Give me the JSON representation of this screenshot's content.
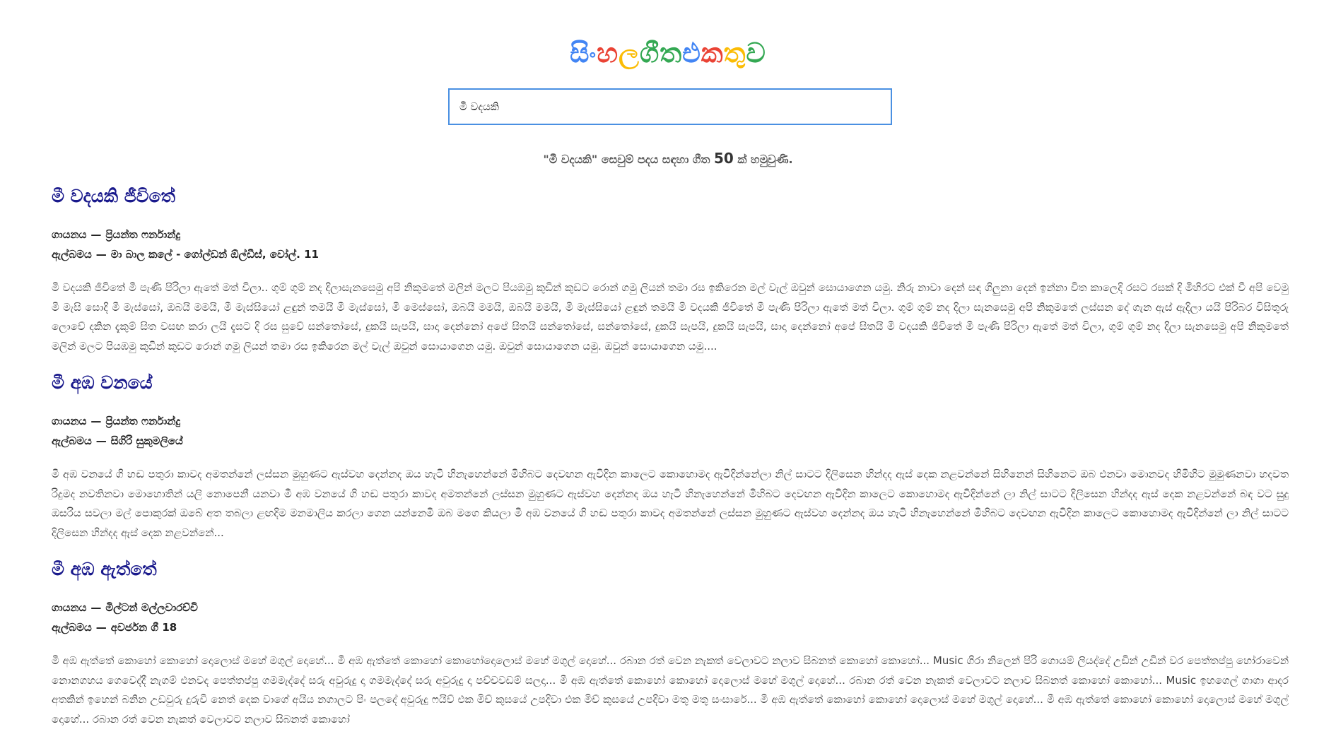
{
  "logo": {
    "letters": [
      {
        "text": "සිං",
        "color": "#4285f4"
      },
      {
        "text": "හ",
        "color": "#ea4335"
      },
      {
        "text": "ල ",
        "color": "#fbbc05"
      },
      {
        "text": "ගී",
        "color": "#34a853"
      },
      {
        "text": "ත ",
        "color": "#34a853"
      },
      {
        "text": "එ",
        "color": "#4285f4"
      },
      {
        "text": "ක",
        "color": "#ea4335"
      },
      {
        "text": "තු",
        "color": "#fbbc05"
      },
      {
        "text": "ව",
        "color": "#34a853"
      }
    ]
  },
  "search": {
    "value": "මී වදයකි"
  },
  "result_summary": {
    "prefix": "\"මී වදයකි\" සෙවුම් පදය සඳහා ගීත",
    "count": "50",
    "suffix": "ක් හමුවුණි."
  },
  "songs": [
    {
      "title": "මී වදයකි ජීවිතේ",
      "singer_label": "ගායනය",
      "singer": "ප්‍රියන්ත ෆර්නාන්දු",
      "album_label": "ඇල්බමය",
      "album": "මා බාල කලේ - ගෝල්ඩන් ඕල්ඩීස්, වෝල්. 11",
      "lyrics": "මී වදයකි ජීවිතේ මී පැණි පිරිලා ඇතේ මත් විලා.. ගුම් ගුම් නද දිලාසැනසෙමු අපි නිකුමතේ මලින් මලට පියඹමු කුඩින් කුඩට රොන් ගමු ලියන් තමා රස ඉකිරෙන මල් වැල් ඔවුන් සොයාගෙන යමු. නිරු නාවා දෙන් සඳ ගිලුනා දෙන් ඉන්නා විත කාලෙදි රසට රසක් දි මිහිරට එක් වී අපි වෙමු මී මැසි සොදි මී මැස්සෝ, ඔබයි මමයි, මී මැස්සියෝ ළඳුන් තමයි මී මැස්සෝ, මී මෙස්සෝ, ඔබයි මමයි, ඔබයි මමයි, මී මැස්සියෝ ළඳුන් තමයි මී වදයකි ජීවිතේ මී පැණි පිරිලා ඇතේ මත් විලා. ගුම් ගුම් නද දිලා සැනසෙමු අපි නිකුමතේ ලස්සන දේ ගැන ඇස් ඇදිලා යයි පිරිබර විසිතුරු ලොවේ දකින දැකුම් සිත වසඟ කරා ලයි දැසට දි රස සුවේ සන්තෝසේ, දුකයි සැපයි, සාදා දෙන්නෝ අපේ සිතයි සන්තෝසේ, සන්තෝසේ, දුකයි සැපයි, දුකයි සැපයි, සාදා දෙන්නෝ අපේ සිතයි මී වදයකි ජීවිතේ මී පැණි පිරිලා ඇතේ මත් විලා, ගුම් ගුම් නද දිලා සැනසෙමු අපි නිකුමතේ මලින් මලට පියඹමු කුඩින් කුඩට රොන් ගමු ලියන් තමා රස ඉකිරෙන මල් වැල් ඔවුන් සොයාගෙන යමු. ඔවුන් සොයාගෙන යමු. ඔවුන් සොයාගෙන යමු...."
    },
    {
      "title": "මී අඹ වනයේ",
      "singer_label": "ගායනය",
      "singer": "ප්‍රියන්ත ෆර්නාන්දු",
      "album_label": "ඇල්බමය",
      "album": "සිගිරි සුකුමලියේ",
      "lyrics": "මී අඹ වනයේ ගි හඬ පතුරා කාවද අමතන්නේ ලස්සන මුහුණට ඇස්වහ දෙන්නද ඔය හැටි හිනැහෙන්නේ මිහිබට දෙවඟන ඇවිදින කාලෙට කොහොමද ඇවිදින්නේලා නිල් සාටට දිලිසෙන හින්දද ඇස් දෙක නළවන්නේ සිහිනෙන් සිහිනෙට ඔබ එනවා මොනවද හිමිහිට මුමුණනවා හදවත රිදුමද නවතිනවා මොහොතින් යලි නොපෙනී යනවා මී අඹ වනයේ ගි හඬ පතුරා කාවද අමතන්නේ ලස්සන මුහුණට ඇස්වහ දෙන්නද ඔය හැටි හිනැහෙන්නේ මිහිබට දෙවඟන ඇවිදින කාලෙට කොහොමද ඇවිදින්නේ ලා නිල් සාටට දිලිසෙන හින්දද ඇස් දෙක නළවන්නේ බඳ වට සුදු ඔසරිය සවලා මල් පොකුරක් ඔබේ අත තබලා ළඟදිම මනමාලිය කරලා ගෙන යන්නෙමි ඔබ මගෙ කියලා මී අඹ වනයේ ගි හඬ පතුරා කාවද අමතන්නේ ලස්සන මුහුණට ඇස්වහ දෙන්නද ඔය හැටි හිනැහෙන්නේ මිහිබට දෙවඟන ඇවිදින කාලෙට කොහොමද ඇවිදින්නේ ලා නිල් සාටට දිලිසෙන හින්දද ඇස් දෙක නළවන්නේ..."
    },
    {
      "title": "මී අඹ ඇත්තේ",
      "singer_label": "ගායනය",
      "singer": "මිල්ටන් මල්ලවාරච්චි",
      "album_label": "ඇල්බමය",
      "album": "අවර්ජන ගී 18",
      "lyrics": "මී අඹ ඇත්තේ කොහෝ කොහෝ දොලොස් මහේ මගුල් දොහේ... මී අඹ ඇත්තේ කොහෝ කොහෝදොලොස් මහේ මගුල් දොහේ... රබාන රත් වෙන නැකත් වෙලාවට නලාව සිබනත් කොහෝ කොහෝ... Music ගිරා නිලෙන් පිරි ගොයම් ලියද්දේ උඩින් උඩින් වර පෙත්තප්පු හෝරාවෙන් නොනගහය ගෙවෙද්දී නැගම් එනවද පෙත්තප්පු ගමමැද්දේ සරු අවුරුදු දා ගමමැද්දේ සරු අවුරුදු දා පච්චවඩම් සලදා... මී අඹ ඇත්තේ කොහෝ කොහෝ දොලොස් මහේ මගුල් දොහේ... රබාන රත් වෙන නැකත් වෙලාවට නලාව සිබනත් කොහෝ කොහෝ... Music ඉහගෙල් ගාගා ආදර අතකින් ඉහෙන් බනින උඩවුරු දුරුවී නෙත් දෙක වාගේ අයිය නගාලට පිං පලදේ අවුරුදු ෆයිව් එක මිච් කුසයේ උපදිවා එක මිච් කුසයේ උපදිවා මතු මතු සංසාරේ... මී අඹ ඇත්තේ කොහෝ කොහෝ දොලොස් මහේ මගුල් දොහේ... මී අඹ ඇත්තේ කොහෝ කොහෝ දොලොස් මහේ මගුල් දොහේ... රබාන රත් වෙන නැකත් වෙලාවට නලාව සිබනත් කොහෝ"
    }
  ]
}
